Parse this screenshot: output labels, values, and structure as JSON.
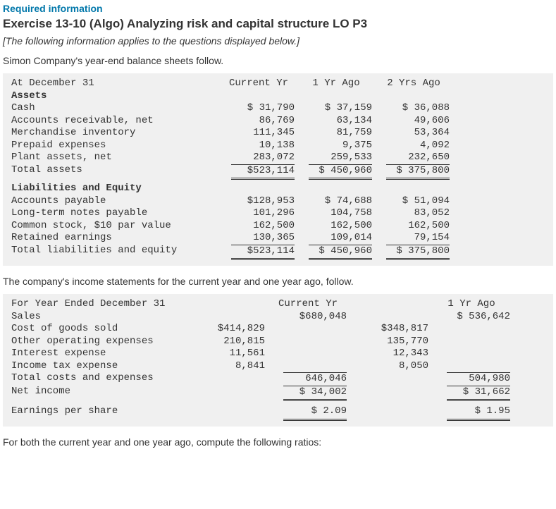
{
  "header": {
    "required": "Required information",
    "title": "Exercise 13-10 (Algo) Analyzing risk and capital structure LO P3",
    "note": "[The following information applies to the questions displayed below.]",
    "intro1": "Simon Company's year-end balance sheets follow.",
    "intro2": "The company's income statements for the current year and one year ago, follow.",
    "intro3": "For both the current year and one year ago, compute the following ratios:"
  },
  "bs": {
    "date_label": "At December 31",
    "col1": "Current Yr",
    "col2": "1 Yr Ago",
    "col3": "2 Yrs Ago",
    "assets_hdr": "Assets",
    "rows": {
      "cash": {
        "l": "Cash",
        "c1": "$ 31,790",
        "c2": "$  37,159",
        "c3": "$  36,088"
      },
      "ar": {
        "l": "Accounts receivable, net",
        "c1": "86,769",
        "c2": "63,134",
        "c3": "49,606"
      },
      "inv": {
        "l": "Merchandise inventory",
        "c1": "111,345",
        "c2": "81,759",
        "c3": "53,364"
      },
      "prepaid": {
        "l": "Prepaid expenses",
        "c1": "10,138",
        "c2": "9,375",
        "c3": "4,092"
      },
      "plant": {
        "l": "Plant assets, net",
        "c1": "283,072",
        "c2": "259,533",
        "c3": "232,650"
      },
      "ta": {
        "l": "Total assets",
        "c1": "$523,114",
        "c2": "$ 450,960",
        "c3": "$ 375,800"
      }
    },
    "liab_hdr": "Liabilities and Equity",
    "lrows": {
      "ap": {
        "l": "Accounts payable",
        "c1": "$128,953",
        "c2": "$  74,688",
        "c3": "$  51,094"
      },
      "ltn": {
        "l": "Long-term notes payable",
        "c1": "101,296",
        "c2": "104,758",
        "c3": "83,052"
      },
      "cs": {
        "l": "Common stock, $10 par value",
        "c1": "162,500",
        "c2": "162,500",
        "c3": "162,500"
      },
      "re": {
        "l": "Retained earnings",
        "c1": "130,365",
        "c2": "109,014",
        "c3": "79,154"
      },
      "tle": {
        "l": "Total liabilities and equity",
        "c1": "$523,114",
        "c2": "$ 450,960",
        "c3": "$ 375,800"
      }
    }
  },
  "is": {
    "date_label": "For Year Ended December 31",
    "col_cur": "Current Yr",
    "col_prior": "1 Yr Ago",
    "sales": {
      "l": "Sales",
      "cur": "$680,048",
      "prior": "$ 536,642"
    },
    "cogs": {
      "l": "Cost of goods sold",
      "cur": "$414,829",
      "prior": "$348,817"
    },
    "oox": {
      "l": "Other operating expenses",
      "cur": "210,815",
      "prior": "135,770"
    },
    "intx": {
      "l": "Interest expense",
      "cur": "11,561",
      "prior": "12,343"
    },
    "tax": {
      "l": "Income tax expense",
      "cur": "8,841",
      "prior": "8,050"
    },
    "tcost": {
      "l": "Total costs and expenses",
      "cur": "646,046",
      "prior": "504,980"
    },
    "ni": {
      "l": "Net income",
      "cur": "$ 34,002",
      "prior": "$  31,662"
    },
    "eps": {
      "l": "Earnings per share",
      "cur": "$   2.09",
      "prior": "$    1.95"
    }
  }
}
